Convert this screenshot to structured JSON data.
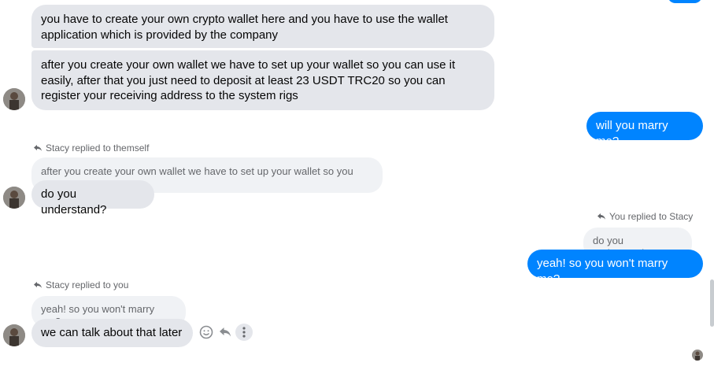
{
  "conversation": {
    "contact_name": "Stacy",
    "messages": [
      {
        "id": "m1",
        "side": "incoming",
        "text": "you have to create your own crypto wallet here and you have to use the wallet application which is provided by the company"
      },
      {
        "id": "m2",
        "side": "incoming",
        "text": "after you create your own wallet we have to set up your wallet so you can use it easily, after that you just need to deposit at least 23 USDT TRC20 so you can register your receiving address to the system rigs"
      },
      {
        "id": "m3",
        "side": "outgoing",
        "text": "will you marry me?"
      },
      {
        "id": "m4",
        "side": "incoming",
        "reply_note": "Stacy replied to themself",
        "quoted": "after you create your own wallet we have to set up your wallet so you ca...",
        "text": "do you understand?"
      },
      {
        "id": "m5",
        "side": "outgoing",
        "reply_note": "You replied to Stacy",
        "quoted": "do you understand?",
        "text": "yeah! so you won't marry me?"
      },
      {
        "id": "m6",
        "side": "incoming",
        "reply_note": "Stacy replied to you",
        "quoted": "yeah! so you won't marry me?",
        "text": "we can talk about that later"
      }
    ],
    "message_actions": [
      "emoji-react-icon",
      "reply-icon",
      "more-options-icon"
    ]
  },
  "colors": {
    "outgoing_bubble": "#0084ff",
    "incoming_bubble": "#e4e6eb",
    "quoted_bubble": "#f0f2f5",
    "meta_text": "#65676b"
  }
}
